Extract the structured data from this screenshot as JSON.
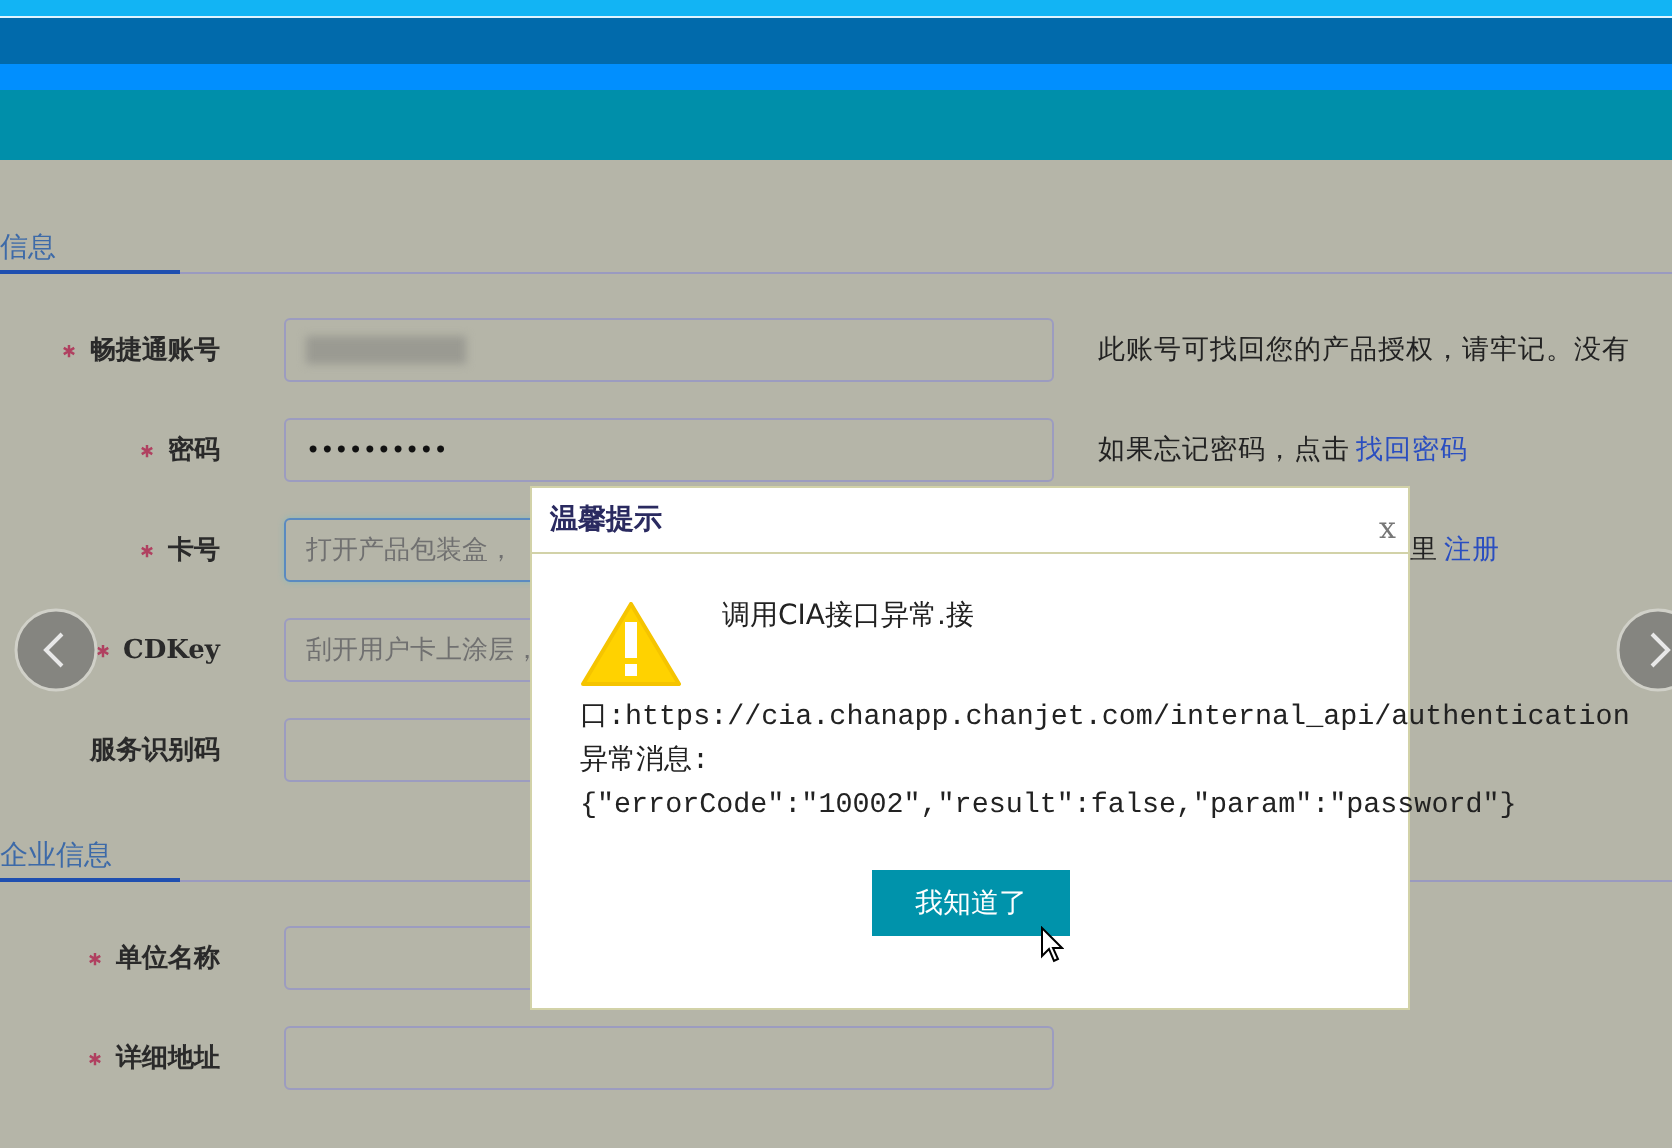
{
  "sections": [
    {
      "title": "信息",
      "rows": [
        {
          "label": "畅捷通账号",
          "required": true,
          "kind": "blurred",
          "hint": "此账号可找回您的产品授权，请牢记。没有"
        },
        {
          "label": "密码",
          "required": true,
          "kind": "password",
          "value": "••••••••••",
          "hint": "如果忘记密码，点击",
          "link": "找回密码"
        },
        {
          "label": "卡号",
          "required": true,
          "kind": "text",
          "focused": true,
          "placeholder": "打开产品包装盒，",
          "hint": "里",
          "link": "注册"
        },
        {
          "label": "CDKey",
          "required": true,
          "kind": "text",
          "placeholder": "刮开用户卡上涂层，"
        },
        {
          "label": "服务识别码",
          "required": false,
          "kind": "text"
        }
      ]
    },
    {
      "title": "企业信息",
      "rows": [
        {
          "label": "单位名称",
          "required": true,
          "kind": "text"
        },
        {
          "label": "详细地址",
          "required": true,
          "kind": "text"
        }
      ]
    }
  ],
  "dialog": {
    "title": "温馨提示",
    "close": "x",
    "lines": [
      "调用CIA接口异常.接",
      "口:https://cia.chanapp.chanjet.com/internal_api/authentication",
      "异常消息:",
      "{\"errorCode\":\"10002\",\"result\":false,\"param\":\"password\"}"
    ],
    "button": "我知道了"
  }
}
